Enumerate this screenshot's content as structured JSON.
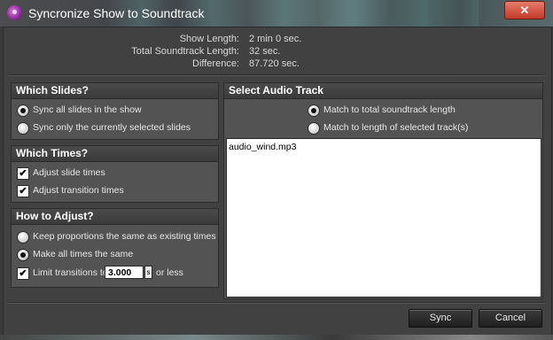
{
  "window": {
    "title": "Syncronize Show to Soundtrack",
    "close_label": "✕"
  },
  "info": [
    {
      "label": "Show Length:",
      "value": "2 min 0 sec."
    },
    {
      "label": "Total Soundtrack Length:",
      "value": "32 sec."
    },
    {
      "label": "Difference:",
      "value": "87.720 sec."
    }
  ],
  "which_slides": {
    "title": "Which Slides?",
    "options": [
      {
        "label": "Sync all slides in the show",
        "selected": true
      },
      {
        "label": "Sync only the currently selected slides",
        "selected": false
      }
    ]
  },
  "which_times": {
    "title": "Which Times?",
    "options": [
      {
        "label": "Adjust slide times",
        "checked": true
      },
      {
        "label": "Adjust transition times",
        "checked": true
      }
    ]
  },
  "how_to_adjust": {
    "title": "How to Adjust?",
    "options": [
      {
        "label": "Keep proportions the same as existing times",
        "selected": false
      },
      {
        "label": "Make all times the same",
        "selected": true
      }
    ],
    "limit": {
      "label": "Limit transitions to",
      "checked": true,
      "value": "3.000",
      "unit": "s",
      "suffix": "or less"
    }
  },
  "audio": {
    "title": "Select Audio Track",
    "options": [
      {
        "label": "Match to total soundtrack length",
        "selected": true
      },
      {
        "label": "Match to length of selected track(s)",
        "selected": false
      }
    ],
    "tracks": [
      "audio_wind.mp3"
    ]
  },
  "buttons": {
    "sync": "Sync",
    "cancel": "Cancel"
  },
  "colors": {
    "panel": "#535353",
    "frame": "#414141",
    "header": "#3b3b3b",
    "close": "#c23a28"
  }
}
